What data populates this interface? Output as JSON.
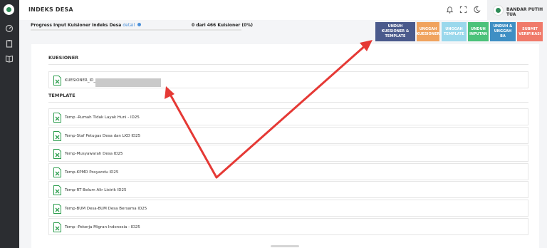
{
  "app": {
    "page_title": "INDEKS DESA"
  },
  "sidebar": {
    "items": [
      {
        "icon": "dashboard-icon"
      },
      {
        "icon": "clipboard-icon"
      },
      {
        "icon": "book-icon"
      }
    ]
  },
  "header": {
    "icons": [
      "bell-icon",
      "fullscreen-icon",
      "moon-icon"
    ],
    "user_name": "BANDAR PUTIH TUA"
  },
  "progress": {
    "label": "Progress Input Kuisioner Indeks Desa",
    "detail_link": "detail",
    "count_text": "0 dari 466 Kuisioner (0%)",
    "percent": 0
  },
  "actions": [
    {
      "label": "UNDUH KUESIONER & TEMPLATE",
      "color": "#4a5a8c"
    },
    {
      "label": "UNGGAH KUESIONER",
      "color": "#f0a35e"
    },
    {
      "label": "UNGGAH TEMPLATE",
      "color": "#9ad8ec"
    },
    {
      "label": "UNDUH INPUTAN",
      "color": "#4bc27a"
    },
    {
      "label": "UNDUH & UNGGAH BA",
      "color": "#3f8fc4"
    },
    {
      "label": "SUBMIT VERIFIKASI",
      "color": "#f07a6a"
    }
  ],
  "kuesioner": {
    "title": "KUESIONER",
    "files": [
      {
        "name": "KUESIONER_ID_"
      }
    ]
  },
  "template": {
    "title": "TEMPLATE",
    "files": [
      {
        "name": "Temp -Rumah Tidak Layak Huni - ID25"
      },
      {
        "name": "Temp-Staf Petugas Desa dan LKD ID25"
      },
      {
        "name": "Temp-Musyawarah Desa ID25"
      },
      {
        "name": "Temp-KPMD Posyandu ID25"
      },
      {
        "name": "Temp-RT Belum Alir Listrik ID25"
      },
      {
        "name": "Temp-BUM Desa-BUM Desa Bersama ID25"
      },
      {
        "name": "Temp -Pekerja Migran Indonesia - ID25"
      }
    ]
  },
  "colors": {
    "annotation_arrow": "#e53935",
    "excel_green": "#2e9e4f"
  }
}
